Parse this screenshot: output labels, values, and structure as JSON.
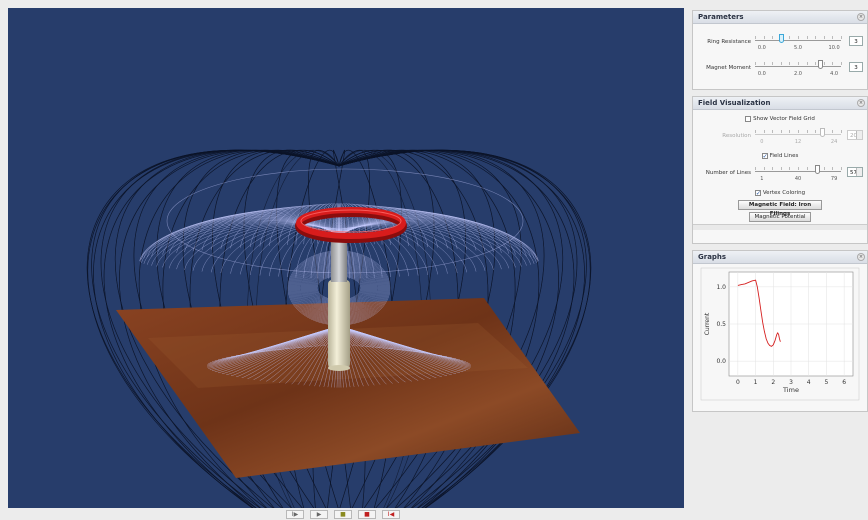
{
  "parameters": {
    "title": "Parameters",
    "ring_resistance": {
      "label": "Ring Resistance",
      "value": "3",
      "fraction": 0.3,
      "ticks": [
        "0.0",
        "5.0",
        "10.0"
      ]
    },
    "magnet_moment": {
      "label": "Magnet Moment",
      "value": "3",
      "fraction": 0.75,
      "ticks": [
        "0.0",
        "2.0",
        "4.0"
      ]
    }
  },
  "field_visualization": {
    "title": "Field Visualization",
    "show_vector_grid": {
      "label": "Show Vector Field Grid",
      "checked": false
    },
    "resolution": {
      "label": "Resolution",
      "value": "20",
      "fraction": 0.78,
      "ticks": [
        "0",
        "12",
        "24"
      ]
    },
    "field_lines": {
      "label": "Field Lines",
      "checked": true
    },
    "number_of_lines": {
      "label": "Number of Lines",
      "value": "57",
      "fraction": 0.72,
      "ticks": [
        "1",
        "40",
        "79"
      ]
    },
    "vertex_coloring": {
      "label": "Vertex Coloring",
      "checked": true
    },
    "iron_filings_button": "Magnetic Field: Iron Filings",
    "potential_button": "Magnetic Potential"
  },
  "graphs": {
    "title": "Graphs",
    "chart_data": {
      "type": "line",
      "xlabel": "Time",
      "ylabel": "Current",
      "xlim": [
        -0.5,
        6.5
      ],
      "ylim": [
        -0.2,
        1.2
      ],
      "xticks": [
        "0",
        "1",
        "2",
        "3",
        "4",
        "5",
        "6"
      ],
      "yticks": [
        "0.0",
        "0.5",
        "1.0"
      ],
      "grid": true,
      "series": [
        {
          "color": "#d62020",
          "x": [
            0.0,
            0.2,
            0.4,
            0.6,
            0.8,
            1.0,
            1.1,
            1.2,
            1.3,
            1.4,
            1.5,
            1.6,
            1.7,
            1.8,
            1.9,
            2.0,
            2.1,
            2.2,
            2.25,
            2.3,
            2.35,
            2.4
          ],
          "y": [
            1.02,
            1.03,
            1.04,
            1.06,
            1.08,
            1.09,
            1.0,
            0.85,
            0.68,
            0.52,
            0.4,
            0.3,
            0.24,
            0.21,
            0.2,
            0.22,
            0.28,
            0.36,
            0.38,
            0.36,
            0.3,
            0.26
          ]
        }
      ]
    }
  },
  "toolbar": {
    "buttons": [
      {
        "name": "step-button",
        "glyph": "I▶"
      },
      {
        "name": "play-button",
        "glyph": "▶"
      },
      {
        "name": "pause-button",
        "glyph": "■"
      },
      {
        "name": "stop-button",
        "glyph": "■"
      },
      {
        "name": "reset-button",
        "glyph": "I◀"
      }
    ]
  },
  "colors": {
    "viewport_bg": "#273d6b",
    "ring": "#d81c1c",
    "field_line": "#c7ccff",
    "magnet": "#e9e4c8",
    "table": "#7a3a1c",
    "current_curve": "#d62020",
    "slider_active": "#3ba7d8"
  }
}
